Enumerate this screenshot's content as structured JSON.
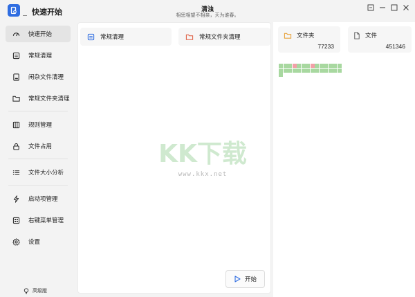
{
  "app": {
    "title": "快速开始",
    "window_title": "清浊",
    "window_subtitle": "相思相望不相亲，天为谁春。"
  },
  "sidebar": {
    "items": [
      {
        "label": "快速开始",
        "icon": "gauge-icon",
        "active": true
      },
      {
        "label": "常规清理",
        "icon": "clean-icon",
        "active": false
      },
      {
        "label": "闲杂文件清理",
        "icon": "image-file-icon",
        "active": false
      },
      {
        "label": "常规文件夹清理",
        "icon": "folder-icon",
        "active": false
      },
      {
        "label": "规则管理",
        "icon": "rules-icon",
        "active": false
      },
      {
        "label": "文件占用",
        "icon": "lock-icon",
        "active": false
      },
      {
        "label": "文件大小分析",
        "icon": "list-icon",
        "active": false
      },
      {
        "label": "启动项管理",
        "icon": "lightning-icon",
        "active": false
      },
      {
        "label": "右键菜单管理",
        "icon": "menu-grid-icon",
        "active": false
      },
      {
        "label": "设置",
        "icon": "gear-icon",
        "active": false
      }
    ],
    "edition": "高级版"
  },
  "main": {
    "cards": [
      {
        "label": "常规清理",
        "icon": "clean-icon"
      },
      {
        "label": "常规文件夹清理",
        "icon": "folder-icon"
      }
    ],
    "watermark": {
      "big": "KK下载",
      "url": "www.kkx.net"
    },
    "start_label": "开始"
  },
  "stats": {
    "folders": {
      "label": "文件夹",
      "value": "77233",
      "icon": "folder-icon"
    },
    "files": {
      "label": "文件",
      "value": "451346",
      "icon": "file-icon"
    }
  },
  "progress_grid": {
    "columns": 14,
    "total_blocks": 29,
    "red_blocks": [
      3,
      7
    ]
  },
  "colors": {
    "accent": "#2f6de1",
    "folder_orange": "#e8a33c",
    "folder_red": "#e0654a",
    "block_green": "#a8d8a0",
    "block_red": "#f2a0a8"
  }
}
